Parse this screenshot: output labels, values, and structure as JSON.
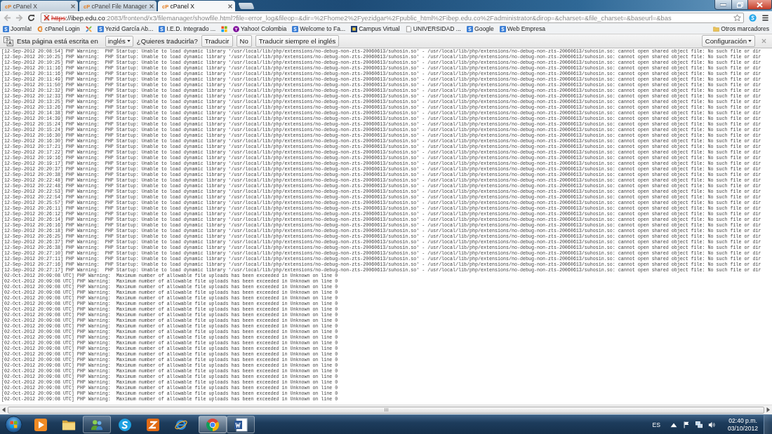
{
  "tabs": [
    {
      "favicon": "cP",
      "title": "cPanel X",
      "selected": false
    },
    {
      "favicon": "cP",
      "title": "cPanel File Manager",
      "selected": false
    },
    {
      "favicon": "cP",
      "title": "cPanel X",
      "selected": true
    }
  ],
  "toolbar": {
    "back": {
      "disabled": true
    },
    "forward": {
      "disabled": true
    },
    "address": {
      "certificate_error": true,
      "scheme": "https",
      "host": "://ibep.edu.co",
      "path": ":2083/frontend/x3/filemanager/showfile.html?file=error_log&fileop=&dir=%2Fhome2%2Fyezidgar%2Fpublic_html%2Fibep.edu.co%2Fadministrator&dirop=&charset=&file_charset=&baseurl=&bas"
    }
  },
  "bookmarks": {
    "items": [
      {
        "kind": "site",
        "label": "Joomla!"
      },
      {
        "kind": "cpanel",
        "label": "cPanel Login"
      },
      {
        "kind": "joomla"
      },
      {
        "kind": "site",
        "label": "Yezid García Ab..."
      },
      {
        "kind": "site",
        "label": "I.E.D. Integrado ..."
      },
      {
        "kind": "windows"
      },
      {
        "kind": "yahoo",
        "label": "Yahoo! Colombia"
      },
      {
        "kind": "site",
        "label": "Welcome to Fa..."
      },
      {
        "kind": "campus",
        "label": "Campus Virtual"
      },
      {
        "kind": "page",
        "label": "UNIVERSIDAD ..."
      },
      {
        "kind": "site",
        "label": "Google"
      },
      {
        "kind": "site",
        "label": "Web Empresa"
      }
    ],
    "other": "Otros marcadores"
  },
  "translate_bar": {
    "message": "Esta página está escrita en",
    "language": "inglés",
    "question": "¿Quieres traducirla?",
    "buttons": [
      "Traducir",
      "No",
      "Traducir siempre el inglés"
    ],
    "settings": "Configuración"
  },
  "log_lines": [
    "[12-Sep-2012 20:08:54] PHP Warning:  PHP Startup: Unable to load dynamic library '/usr/local/lib/php/extensions/no-debug-non-zts-20060613/suhosin.so' - /usr/local/lib/php/extensions/no-debug-non-zts-20060613/suhosin.so: cannot open shared object file: No such file or dir",
    "[12-Sep-2012 20:10:25] PHP Warning:  PHP Startup: Unable to load dynamic library '/usr/local/lib/php/extensions/no-debug-non-zts-20060613/suhosin.so' - /usr/local/lib/php/extensions/no-debug-non-zts-20060613/suhosin.so: cannot open shared object file: No such file or dir",
    "[12-Sep-2012 20:10:25] PHP Warning:  PHP Startup: Unable to load dynamic library '/usr/local/lib/php/extensions/no-debug-non-zts-20060613/suhosin.so' - /usr/local/lib/php/extensions/no-debug-non-zts-20060613/suhosin.so: cannot open shared object file: No such file or dir",
    "[12-Sep-2012 20:11:16] PHP Warning:  PHP Startup: Unable to load dynamic library '/usr/local/lib/php/extensions/no-debug-non-zts-20060613/suhosin.so' - /usr/local/lib/php/extensions/no-debug-non-zts-20060613/suhosin.so: cannot open shared object file: No such file or dir",
    "[12-Sep-2012 20:11:16] PHP Warning:  PHP Startup: Unable to load dynamic library '/usr/local/lib/php/extensions/no-debug-non-zts-20060613/suhosin.so' - /usr/local/lib/php/extensions/no-debug-non-zts-20060613/suhosin.so: cannot open shared object file: No such file or dir",
    "[12-Sep-2012 20:11:49] PHP Warning:  PHP Startup: Unable to load dynamic library '/usr/local/lib/php/extensions/no-debug-non-zts-20060613/suhosin.so' - /usr/local/lib/php/extensions/no-debug-non-zts-20060613/suhosin.so: cannot open shared object file: No such file or dir",
    "[12-Sep-2012 20:11:50] PHP Warning:  PHP Startup: Unable to load dynamic library '/usr/local/lib/php/extensions/no-debug-non-zts-20060613/suhosin.so' - /usr/local/lib/php/extensions/no-debug-non-zts-20060613/suhosin.so: cannot open shared object file: No such file or dir",
    "[12-Sep-2012 20:12:32] PHP Warning:  PHP Startup: Unable to load dynamic library '/usr/local/lib/php/extensions/no-debug-non-zts-20060613/suhosin.so' - /usr/local/lib/php/extensions/no-debug-non-zts-20060613/suhosin.so: cannot open shared object file: No such file or dir",
    "[12-Sep-2012 20:12:33] PHP Warning:  PHP Startup: Unable to load dynamic library '/usr/local/lib/php/extensions/no-debug-non-zts-20060613/suhosin.so' - /usr/local/lib/php/extensions/no-debug-non-zts-20060613/suhosin.so: cannot open shared object file: No such file or dir",
    "[12-Sep-2012 20:13:25] PHP Warning:  PHP Startup: Unable to load dynamic library '/usr/local/lib/php/extensions/no-debug-non-zts-20060613/suhosin.so' - /usr/local/lib/php/extensions/no-debug-non-zts-20060613/suhosin.so: cannot open shared object file: No such file or dir",
    "[12-Sep-2012 20:13:26] PHP Warning:  PHP Startup: Unable to load dynamic library '/usr/local/lib/php/extensions/no-debug-non-zts-20060613/suhosin.so' - /usr/local/lib/php/extensions/no-debug-non-zts-20060613/suhosin.so: cannot open shared object file: No such file or dir",
    "[12-Sep-2012 20:14:38] PHP Warning:  PHP Startup: Unable to load dynamic library '/usr/local/lib/php/extensions/no-debug-non-zts-20060613/suhosin.so' - /usr/local/lib/php/extensions/no-debug-non-zts-20060613/suhosin.so: cannot open shared object file: No such file or dir",
    "[12-Sep-2012 20:14:39] PHP Warning:  PHP Startup: Unable to load dynamic library '/usr/local/lib/php/extensions/no-debug-non-zts-20060613/suhosin.so' - /usr/local/lib/php/extensions/no-debug-non-zts-20060613/suhosin.so: cannot open shared object file: No such file or dir",
    "[12-Sep-2012 20:15:24] PHP Warning:  PHP Startup: Unable to load dynamic library '/usr/local/lib/php/extensions/no-debug-non-zts-20060613/suhosin.so' - /usr/local/lib/php/extensions/no-debug-non-zts-20060613/suhosin.so: cannot open shared object file: No such file or dir",
    "[12-Sep-2012 20:15:24] PHP Warning:  PHP Startup: Unable to load dynamic library '/usr/local/lib/php/extensions/no-debug-non-zts-20060613/suhosin.so' - /usr/local/lib/php/extensions/no-debug-non-zts-20060613/suhosin.so: cannot open shared object file: No such file or dir",
    "[12-Sep-2012 20:16:30] PHP Warning:  PHP Startup: Unable to load dynamic library '/usr/local/lib/php/extensions/no-debug-non-zts-20060613/suhosin.so' - /usr/local/lib/php/extensions/no-debug-non-zts-20060613/suhosin.so: cannot open shared object file: No such file or dir",
    "[12-Sep-2012 20:16:30] PHP Warning:  PHP Startup: Unable to load dynamic library '/usr/local/lib/php/extensions/no-debug-non-zts-20060613/suhosin.so' - /usr/local/lib/php/extensions/no-debug-non-zts-20060613/suhosin.so: cannot open shared object file: No such file or dir",
    "[12-Sep-2012 20:17:21] PHP Warning:  PHP Startup: Unable to load dynamic library '/usr/local/lib/php/extensions/no-debug-non-zts-20060613/suhosin.so' - /usr/local/lib/php/extensions/no-debug-non-zts-20060613/suhosin.so: cannot open shared object file: No such file or dir",
    "[12-Sep-2012 20:17:22] PHP Warning:  PHP Startup: Unable to load dynamic library '/usr/local/lib/php/extensions/no-debug-non-zts-20060613/suhosin.so' - /usr/local/lib/php/extensions/no-debug-non-zts-20060613/suhosin.so: cannot open shared object file: No such file or dir",
    "[12-Sep-2012 20:19:16] PHP Warning:  PHP Startup: Unable to load dynamic library '/usr/local/lib/php/extensions/no-debug-non-zts-20060613/suhosin.so' - /usr/local/lib/php/extensions/no-debug-non-zts-20060613/suhosin.so: cannot open shared object file: No such file or dir",
    "[12-Sep-2012 20:19:17] PHP Warning:  PHP Startup: Unable to load dynamic library '/usr/local/lib/php/extensions/no-debug-non-zts-20060613/suhosin.so' - /usr/local/lib/php/extensions/no-debug-non-zts-20060613/suhosin.so: cannot open shared object file: No such file or dir",
    "[12-Sep-2012 20:20:37] PHP Warning:  PHP Startup: Unable to load dynamic library '/usr/local/lib/php/extensions/no-debug-non-zts-20060613/suhosin.so' - /usr/local/lib/php/extensions/no-debug-non-zts-20060613/suhosin.so: cannot open shared object file: No such file or dir",
    "[12-Sep-2012 20:20:38] PHP Warning:  PHP Startup: Unable to load dynamic library '/usr/local/lib/php/extensions/no-debug-non-zts-20060613/suhosin.so' - /usr/local/lib/php/extensions/no-debug-non-zts-20060613/suhosin.so: cannot open shared object file: No such file or dir",
    "[12-Sep-2012 20:22:48] PHP Warning:  PHP Startup: Unable to load dynamic library '/usr/local/lib/php/extensions/no-debug-non-zts-20060613/suhosin.so' - /usr/local/lib/php/extensions/no-debug-non-zts-20060613/suhosin.so: cannot open shared object file: No such file or dir",
    "[12-Sep-2012 20:22:48] PHP Warning:  PHP Startup: Unable to load dynamic library '/usr/local/lib/php/extensions/no-debug-non-zts-20060613/suhosin.so' - /usr/local/lib/php/extensions/no-debug-non-zts-20060613/suhosin.so: cannot open shared object file: No such file or dir",
    "[12-Sep-2012 20:22:53] PHP Warning:  PHP Startup: Unable to load dynamic library '/usr/local/lib/php/extensions/no-debug-non-zts-20060613/suhosin.so' - /usr/local/lib/php/extensions/no-debug-non-zts-20060613/suhosin.so: cannot open shared object file: No such file or dir",
    "[12-Sep-2012 20:22:54] PHP Warning:  PHP Startup: Unable to load dynamic library '/usr/local/lib/php/extensions/no-debug-non-zts-20060613/suhosin.so' - /usr/local/lib/php/extensions/no-debug-non-zts-20060613/suhosin.so: cannot open shared object file: No such file or dir",
    "[12-Sep-2012 20:25:57] PHP Warning:  PHP Startup: Unable to load dynamic library '/usr/local/lib/php/extensions/no-debug-non-zts-20060613/suhosin.so' - /usr/local/lib/php/extensions/no-debug-non-zts-20060613/suhosin.so: cannot open shared object file: No such file or dir",
    "[12-Sep-2012 20:26:11] PHP Warning:  PHP Startup: Unable to load dynamic library '/usr/local/lib/php/extensions/no-debug-non-zts-20060613/suhosin.so' - /usr/local/lib/php/extensions/no-debug-non-zts-20060613/suhosin.so: cannot open shared object file: No such file or dir",
    "[12-Sep-2012 20:26:12] PHP Warning:  PHP Startup: Unable to load dynamic library '/usr/local/lib/php/extensions/no-debug-non-zts-20060613/suhosin.so' - /usr/local/lib/php/extensions/no-debug-non-zts-20060613/suhosin.so: cannot open shared object file: No such file or dir",
    "[12-Sep-2012 20:26:14] PHP Warning:  PHP Startup: Unable to load dynamic library '/usr/local/lib/php/extensions/no-debug-non-zts-20060613/suhosin.so' - /usr/local/lib/php/extensions/no-debug-non-zts-20060613/suhosin.so: cannot open shared object file: No such file or dir",
    "[12-Sep-2012 20:26:16] PHP Warning:  PHP Startup: Unable to load dynamic library '/usr/local/lib/php/extensions/no-debug-non-zts-20060613/suhosin.so' - /usr/local/lib/php/extensions/no-debug-non-zts-20060613/suhosin.so: cannot open shared object file: No such file or dir",
    "[12-Sep-2012 20:26:18] PHP Warning:  PHP Startup: Unable to load dynamic library '/usr/local/lib/php/extensions/no-debug-non-zts-20060613/suhosin.so' - /usr/local/lib/php/extensions/no-debug-non-zts-20060613/suhosin.so: cannot open shared object file: No such file or dir",
    "[12-Sep-2012 20:26:25] PHP Warning:  PHP Startup: Unable to load dynamic library '/usr/local/lib/php/extensions/no-debug-non-zts-20060613/suhosin.so' - /usr/local/lib/php/extensions/no-debug-non-zts-20060613/suhosin.so: cannot open shared object file: No such file or dir",
    "[12-Sep-2012 20:26:37] PHP Warning:  PHP Startup: Unable to load dynamic library '/usr/local/lib/php/extensions/no-debug-non-zts-20060613/suhosin.so' - /usr/local/lib/php/extensions/no-debug-non-zts-20060613/suhosin.so: cannot open shared object file: No such file or dir",
    "[12-Sep-2012 20:26:38] PHP Warning:  PHP Startup: Unable to load dynamic library '/usr/local/lib/php/extensions/no-debug-non-zts-20060613/suhosin.so' - /usr/local/lib/php/extensions/no-debug-non-zts-20060613/suhosin.so: cannot open shared object file: No such file or dir",
    "[12-Sep-2012 20:27:10] PHP Warning:  PHP Startup: Unable to load dynamic library '/usr/local/lib/php/extensions/no-debug-non-zts-20060613/suhosin.so' - /usr/local/lib/php/extensions/no-debug-non-zts-20060613/suhosin.so: cannot open shared object file: No such file or dir",
    "[12-Sep-2012 20:27:11] PHP Warning:  PHP Startup: Unable to load dynamic library '/usr/local/lib/php/extensions/no-debug-non-zts-20060613/suhosin.so' - /usr/local/lib/php/extensions/no-debug-non-zts-20060613/suhosin.so: cannot open shared object file: No such file or dir",
    "[12-Sep-2012 20:27:16] PHP Warning:  PHP Startup: Unable to load dynamic library '/usr/local/lib/php/extensions/no-debug-non-zts-20060613/suhosin.so' - /usr/local/lib/php/extensions/no-debug-non-zts-20060613/suhosin.so: cannot open shared object file: No such file or dir",
    "[12-Sep-2012 20:27:17] PHP Warning:  PHP Startup: Unable to load dynamic library '/usr/local/lib/php/extensions/no-debug-non-zts-20060613/suhosin.so' - /usr/local/lib/php/extensions/no-debug-non-zts-20060613/suhosin.so: cannot open shared object file: No such file or dir",
    "[02-Oct-2012 20:09:08 UTC] PHP Warning:  Maximum number of allowable file uploads has been exceeded in Unknown on line 0",
    "[02-Oct-2012 20:09:08 UTC] PHP Warning:  Maximum number of allowable file uploads has been exceeded in Unknown on line 0",
    "[02-Oct-2012 20:09:08 UTC] PHP Warning:  Maximum number of allowable file uploads has been exceeded in Unknown on line 0",
    "[02-Oct-2012 20:09:08 UTC] PHP Warning:  Maximum number of allowable file uploads has been exceeded in Unknown on line 0",
    "[02-Oct-2012 20:09:08 UTC] PHP Warning:  Maximum number of allowable file uploads has been exceeded in Unknown on line 0",
    "[02-Oct-2012 20:09:08 UTC] PHP Warning:  Maximum number of allowable file uploads has been exceeded in Unknown on line 0",
    "[02-Oct-2012 20:09:08 UTC] PHP Warning:  Maximum number of allowable file uploads has been exceeded in Unknown on line 0",
    "[02-Oct-2012 20:09:08 UTC] PHP Warning:  Maximum number of allowable file uploads has been exceeded in Unknown on line 0",
    "[02-Oct-2012 20:09:08 UTC] PHP Warning:  Maximum number of allowable file uploads has been exceeded in Unknown on line 0",
    "[02-Oct-2012 20:09:08 UTC] PHP Warning:  Maximum number of allowable file uploads has been exceeded in Unknown on line 0",
    "[02-Oct-2012 20:09:08 UTC] PHP Warning:  Maximum number of allowable file uploads has been exceeded in Unknown on line 0",
    "[02-Oct-2012 20:09:08 UTC] PHP Warning:  Maximum number of allowable file uploads has been exceeded in Unknown on line 0",
    "[02-Oct-2012 20:09:08 UTC] PHP Warning:  Maximum number of allowable file uploads has been exceeded in Unknown on line 0",
    "[02-Oct-2012 20:09:08 UTC] PHP Warning:  Maximum number of allowable file uploads has been exceeded in Unknown on line 0",
    "[02-Oct-2012 20:09:08 UTC] PHP Warning:  Maximum number of allowable file uploads has been exceeded in Unknown on line 0",
    "[02-Oct-2012 20:09:08 UTC] PHP Warning:  Maximum number of allowable file uploads has been exceeded in Unknown on line 0",
    "[02-Oct-2012 20:09:08 UTC] PHP Warning:  Maximum number of allowable file uploads has been exceeded in Unknown on line 0",
    "[02-Oct-2012 20:09:08 UTC] PHP Warning:  Maximum number of allowable file uploads has been exceeded in Unknown on line 0",
    "[02-Oct-2012 20:09:08 UTC] PHP Warning:  Maximum number of allowable file uploads has been exceeded in Unknown on line 0",
    "[02-Oct-2012 20:09:08 UTC] PHP Warning:  Maximum number of allowable file uploads has been exceeded in Unknown on line 0",
    "[02-Oct-2012 20:09:08 UTC] PHP Warning:  Maximum number of allowable file uploads has been exceeded in Unknown on line 0",
    "[02-Oct-2012 20:09:08 UTC] PHP Warning:  Maximum number of allowable file uploads has been exceeded in Unknown on line 0",
    "[02-Oct-2012 20:09:08 UTC] PHP Warning:  Maximum number of allowable file uploads has been exceeded in Unknown on line 0"
  ],
  "taskbar": {
    "apps": [
      {
        "kind": "play",
        "running": false,
        "selected": false
      },
      {
        "kind": "folder",
        "running": false,
        "selected": false
      },
      {
        "kind": "people",
        "running": true,
        "selected": false
      },
      {
        "kind": "round",
        "running": false,
        "selected": false
      },
      {
        "kind": "zigzag",
        "running": false,
        "selected": false
      },
      {
        "kind": "ring",
        "running": false,
        "selected": false
      },
      {
        "kind": "ball",
        "running": true,
        "selected": true
      },
      {
        "kind": "document",
        "running": true,
        "selected": false
      }
    ],
    "language": "ES",
    "time": "02:40 p.m.",
    "date": "03/10/2012"
  }
}
